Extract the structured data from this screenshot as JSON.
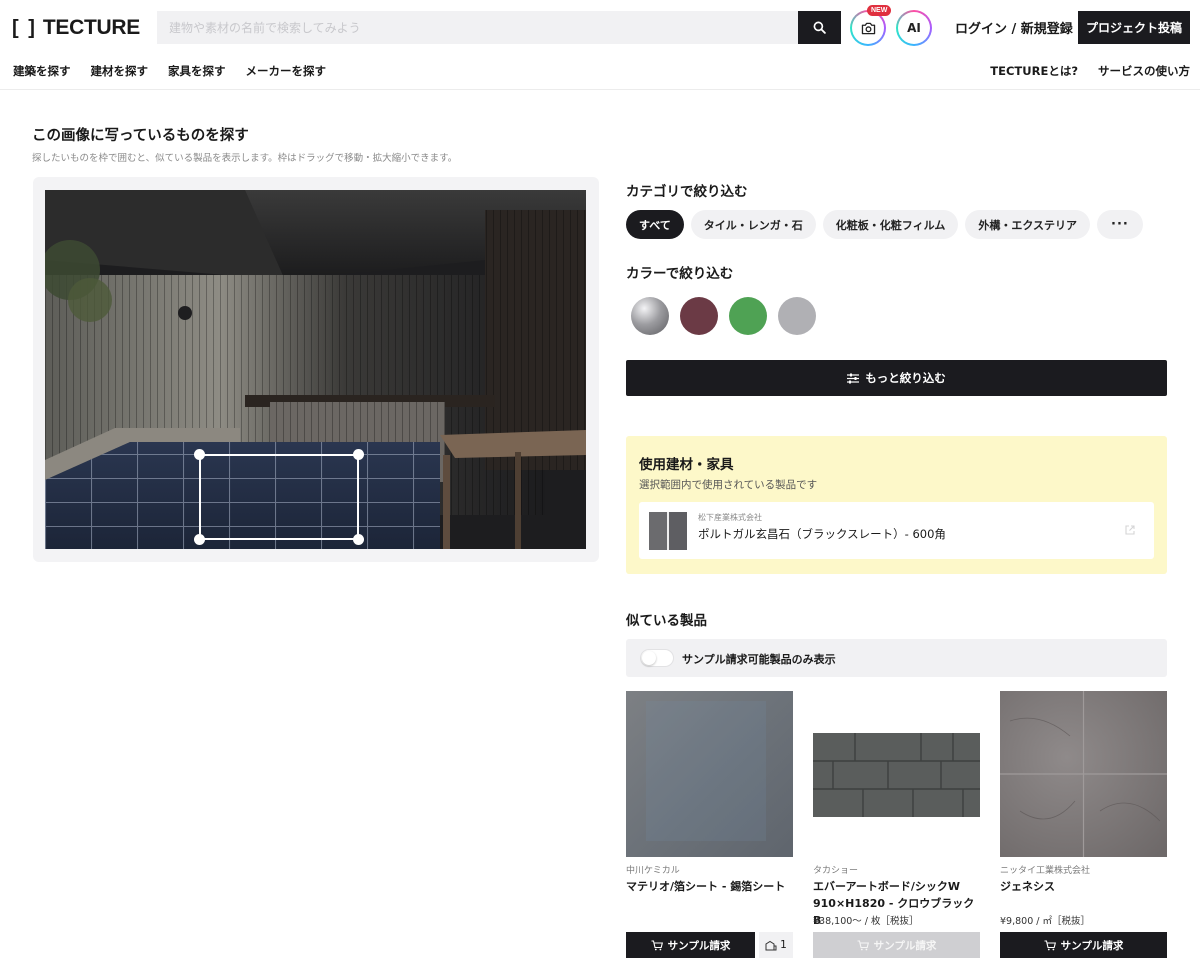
{
  "header": {
    "logo_text": "TECTURE",
    "search": {
      "placeholder": "建物や素材の名前で検索してみよう",
      "value": ""
    },
    "new_badge": "NEW",
    "ai_label": "AI",
    "login_label": "ログイン / 新規登録",
    "post_label": "プロジェクト投稿"
  },
  "subnav": {
    "left": [
      "建築を探す",
      "建材を探す",
      "家具を探す",
      "メーカーを探す"
    ],
    "right": [
      "TECTUREとは?",
      "サービスの使い方"
    ]
  },
  "image_search": {
    "title": "この画像に写っているものを探す",
    "description": "探したいものを枠で囲むと、似ている製品を表示します。枠はドラッグで移動・拡大縮小できます。"
  },
  "category_filter": {
    "title": "カテゴリで絞り込む",
    "chips": [
      "すべて",
      "タイル・レンガ・石",
      "化粧板・化粧フィルム",
      "外構・エクステリア"
    ],
    "more": "···"
  },
  "color_filter": {
    "title": "カラーで絞り込む",
    "swatch_colors": [
      "#8e8e92",
      "#6b3a45",
      "#4fa254",
      "#b0b0b4"
    ]
  },
  "more_filter_label": "もっと絞り込む",
  "used_materials": {
    "title": "使用建材・家具",
    "subtitle": "選択範囲内で使用されている製品です",
    "items": [
      {
        "maker": "松下産業株式会社",
        "name": "ポルトガル玄昌石（ブラックスレート）- 600角"
      }
    ]
  },
  "similar": {
    "title": "似ている製品",
    "toggle_label": "サンプル請求可能製品のみ表示",
    "products": [
      {
        "maker": "中川ケミカル",
        "name": "マテリオ/箔シート - 錫箔シート",
        "price": "",
        "button": "サンプル請求",
        "count": "1"
      },
      {
        "maker": "タカショー",
        "name": "エバーアートボード/シックW 910×H1820 - クロウブラックB",
        "price": "¥38,100〜 / 枚［税抜］",
        "button": "サンプル請求"
      },
      {
        "maker": "ニッタイ工業株式会社",
        "name": "ジェネシス",
        "price": "¥9,800 / ㎡［税抜］",
        "button": "サンプル請求"
      }
    ]
  },
  "colors": {
    "accent_dark": "#1b1b1f",
    "highlight_bg": "#fdf8c9",
    "badge_red": "#e0303f"
  }
}
